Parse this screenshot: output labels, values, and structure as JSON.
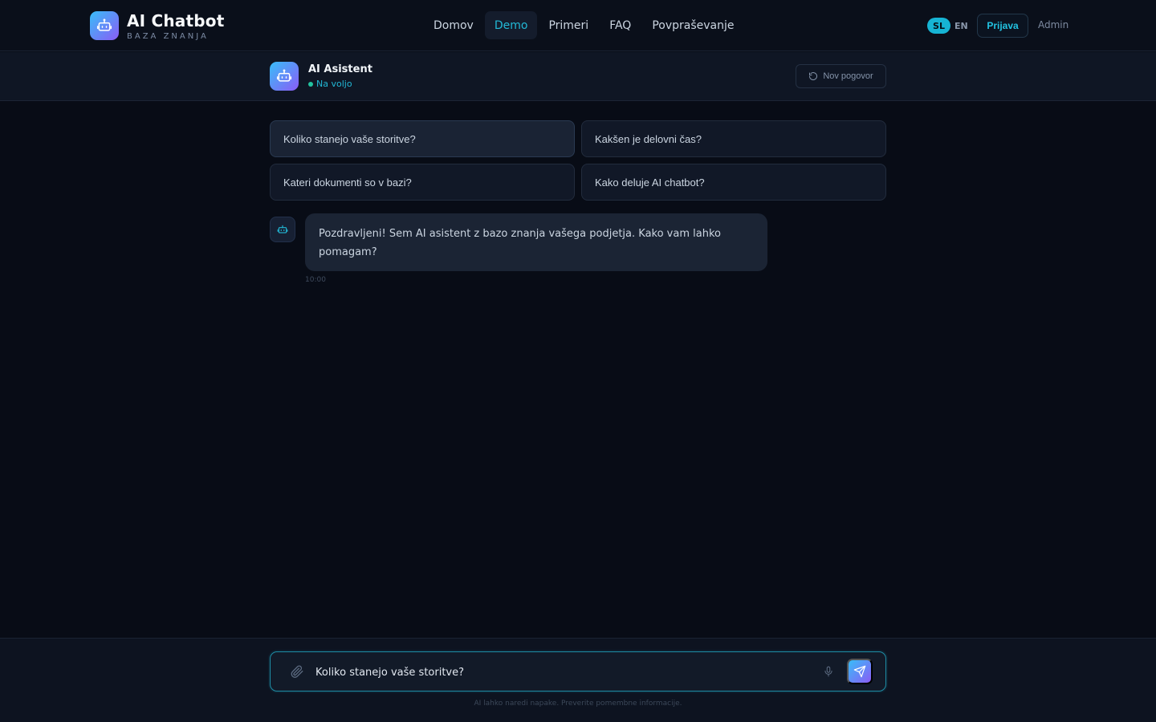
{
  "brand": {
    "title": "AI Chatbot",
    "subtitle": "BAZA ZNANJA",
    "logo_icon": "robot-icon"
  },
  "nav": {
    "items": [
      {
        "label": "Domov",
        "active": false
      },
      {
        "label": "Demo",
        "active": true
      },
      {
        "label": "Primeri",
        "active": false
      },
      {
        "label": "FAQ",
        "active": false
      },
      {
        "label": "Povpraševanje",
        "active": false
      }
    ]
  },
  "lang": {
    "active": "SL",
    "other": "EN"
  },
  "auth": {
    "login_label": "Prijava",
    "admin_label": "Admin"
  },
  "chat_header": {
    "bot_name": "AI Asistent",
    "status": "Na voljo",
    "new_chat_label": "Nov pogovor"
  },
  "suggestions": [
    "Koliko stanejo vaše storitve?",
    "Kakšen je delovni čas?",
    "Kateri dokumenti so v bazi?",
    "Kako deluje AI chatbot?"
  ],
  "messages": [
    {
      "role": "bot",
      "text": "Pozdravljeni! Sem AI asistent z bazo znanja vašega podjetja. Kako vam lahko pomagam?",
      "time": "10:00"
    }
  ],
  "composer": {
    "value": "Koliko stanejo vaše storitve?",
    "disclaimer": "AI lahko naredi napake. Preverite pomembne informacije."
  },
  "colors": {
    "accent": "#22b8d6",
    "background": "#080c16",
    "gradient_start": "#38bdf8",
    "gradient_end": "#8b5cf6"
  }
}
